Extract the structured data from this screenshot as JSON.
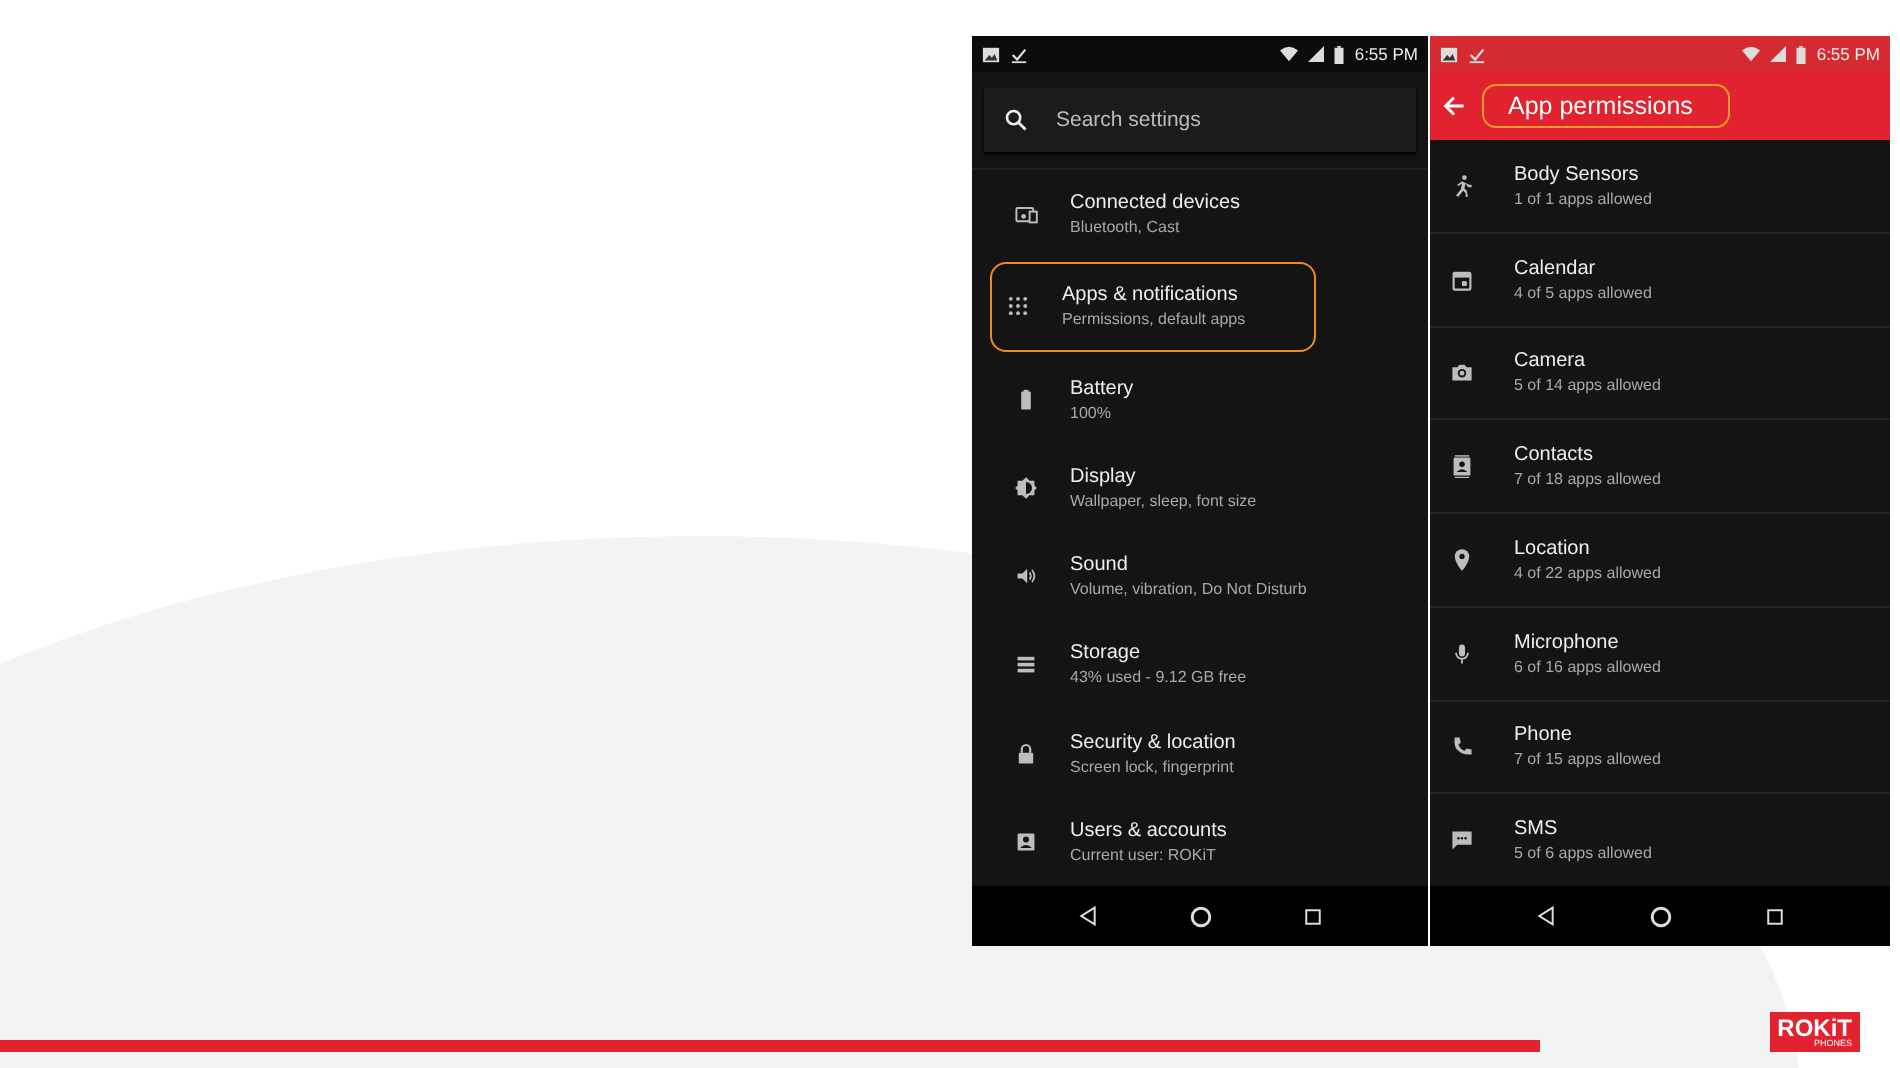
{
  "settings_screen": {
    "status_bar": {
      "time": "6:55 PM"
    },
    "search": {
      "placeholder": "Search settings"
    },
    "items": [
      {
        "kind": "devices",
        "title": "Connected devices",
        "subtitle": "Bluetooth, Cast",
        "highlighted": false
      },
      {
        "kind": "apps",
        "title": "Apps & notifications",
        "subtitle": "Permissions, default apps",
        "highlighted": true
      },
      {
        "kind": "battery",
        "title": "Battery",
        "subtitle": "100%",
        "highlighted": false
      },
      {
        "kind": "display",
        "title": "Display",
        "subtitle": "Wallpaper, sleep, font size",
        "highlighted": false
      },
      {
        "kind": "sound",
        "title": "Sound",
        "subtitle": "Volume, vibration, Do Not Disturb",
        "highlighted": false
      },
      {
        "kind": "storage",
        "title": "Storage",
        "subtitle": "43% used - 9.12 GB free",
        "highlighted": false
      },
      {
        "kind": "lock",
        "title": "Security & location",
        "subtitle": "Screen lock, fingerprint",
        "highlighted": false
      },
      {
        "kind": "account",
        "title": "Users & accounts",
        "subtitle": "Current user: ROKiT",
        "highlighted": false
      }
    ]
  },
  "permissions_screen": {
    "status_bar": {
      "time": "6:55 PM"
    },
    "title": "App permissions",
    "title_highlighted": true,
    "items": [
      {
        "kind": "run",
        "title": "Body Sensors",
        "subtitle": "1 of 1 apps allowed"
      },
      {
        "kind": "calendar",
        "title": "Calendar",
        "subtitle": "4 of 5 apps allowed"
      },
      {
        "kind": "camera",
        "title": "Camera",
        "subtitle": "5 of 14 apps allowed"
      },
      {
        "kind": "contacts",
        "title": "Contacts",
        "subtitle": "7 of 18 apps allowed"
      },
      {
        "kind": "location",
        "title": "Location",
        "subtitle": "4 of 22 apps allowed"
      },
      {
        "kind": "mic",
        "title": "Microphone",
        "subtitle": "6 of 16 apps allowed"
      },
      {
        "kind": "phone",
        "title": "Phone",
        "subtitle": "7 of 15 apps allowed"
      },
      {
        "kind": "sms",
        "title": "SMS",
        "subtitle": "5 of 6 apps allowed"
      }
    ]
  },
  "logo": {
    "name": "ROKiT",
    "tagline": "PHONES"
  }
}
